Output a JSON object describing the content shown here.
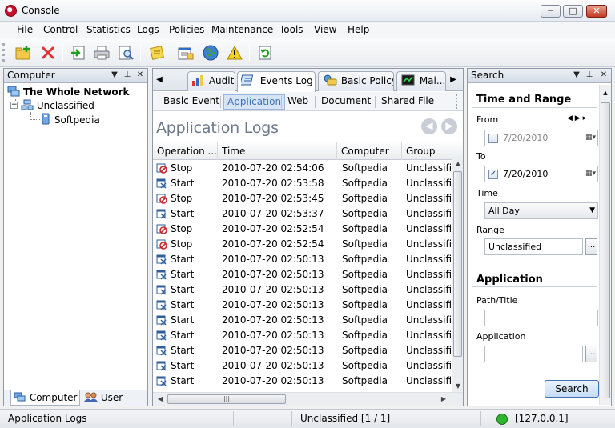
{
  "window": {
    "title": "Console",
    "minimize": "─",
    "maximize": "□",
    "close": "✕"
  },
  "menu": [
    "File",
    "Control",
    "Statistics",
    "Logs",
    "Policies",
    "Maintenance",
    "Tools",
    "View",
    "Help"
  ],
  "toolbar_icons": [
    "new-icon",
    "delete-icon",
    "import-icon",
    "print-icon",
    "print-preview-icon",
    "note-icon",
    "report-icon",
    "globe-icon",
    "warning-icon",
    "refresh-icon"
  ],
  "left_panel": {
    "title": "Computer",
    "tree": {
      "root": "The Whole Network",
      "group": "Unclassified",
      "computer": "Softpedia"
    },
    "tabs": {
      "computer": "Computer",
      "user": "User"
    }
  },
  "center": {
    "tabs": [
      "Audit",
      "Events Log",
      "Basic Policy",
      "Mai..."
    ],
    "sub_tabs": [
      "Basic Event",
      "Application",
      "Web",
      "Document",
      "Shared File"
    ],
    "heading": "Application Logs",
    "columns": [
      "Operation ...",
      "Time",
      "Computer",
      "Group"
    ],
    "rows": [
      {
        "op": "Stop",
        "time": "2010-07-20 02:54:06",
        "computer": "Softpedia",
        "group": "Unclassified"
      },
      {
        "op": "Start",
        "time": "2010-07-20 02:53:58",
        "computer": "Softpedia",
        "group": "Unclassified"
      },
      {
        "op": "Stop",
        "time": "2010-07-20 02:53:45",
        "computer": "Softpedia",
        "group": "Unclassified"
      },
      {
        "op": "Start",
        "time": "2010-07-20 02:53:37",
        "computer": "Softpedia",
        "group": "Unclassified"
      },
      {
        "op": "Stop",
        "time": "2010-07-20 02:52:54",
        "computer": "Softpedia",
        "group": "Unclassified"
      },
      {
        "op": "Stop",
        "time": "2010-07-20 02:52:54",
        "computer": "Softpedia",
        "group": "Unclassified"
      },
      {
        "op": "Start",
        "time": "2010-07-20 02:50:13",
        "computer": "Softpedia",
        "group": "Unclassified"
      },
      {
        "op": "Start",
        "time": "2010-07-20 02:50:13",
        "computer": "Softpedia",
        "group": "Unclassified"
      },
      {
        "op": "Start",
        "time": "2010-07-20 02:50:13",
        "computer": "Softpedia",
        "group": "Unclassified"
      },
      {
        "op": "Start",
        "time": "2010-07-20 02:50:13",
        "computer": "Softpedia",
        "group": "Unclassified"
      },
      {
        "op": "Start",
        "time": "2010-07-20 02:50:13",
        "computer": "Softpedia",
        "group": "Unclassified"
      },
      {
        "op": "Start",
        "time": "2010-07-20 02:50:13",
        "computer": "Softpedia",
        "group": "Unclassified"
      },
      {
        "op": "Start",
        "time": "2010-07-20 02:50:13",
        "computer": "Softpedia",
        "group": "Unclassified"
      },
      {
        "op": "Start",
        "time": "2010-07-20 02:50:13",
        "computer": "Softpedia",
        "group": "Unclassified"
      },
      {
        "op": "Start",
        "time": "2010-07-20 02:50:13",
        "computer": "Softpedia",
        "group": "Unclassified"
      }
    ]
  },
  "search": {
    "title": "Search",
    "time_section": "Time and Range",
    "from_label": "From",
    "from_value": "7/20/2010",
    "from_checked": false,
    "to_label": "To",
    "to_value": "7/20/2010",
    "to_checked": true,
    "time_label": "Time",
    "time_value": "All Day",
    "range_label": "Range",
    "range_value": "Unclassified",
    "app_section": "Application",
    "path_label": "Path/Title",
    "path_value": "",
    "application_label": "Application",
    "application_value": "",
    "button": "Search",
    "dots": "..."
  },
  "status": {
    "left": "Application Logs",
    "middle": "Unclassified [1 / 1]",
    "right": "[127.0.0.1]",
    "indicator_color": "#2fb52f"
  },
  "colors": {
    "accent": "#3d6fb6",
    "heading": "#6d7a8c",
    "stop_icon": "#c62828"
  }
}
